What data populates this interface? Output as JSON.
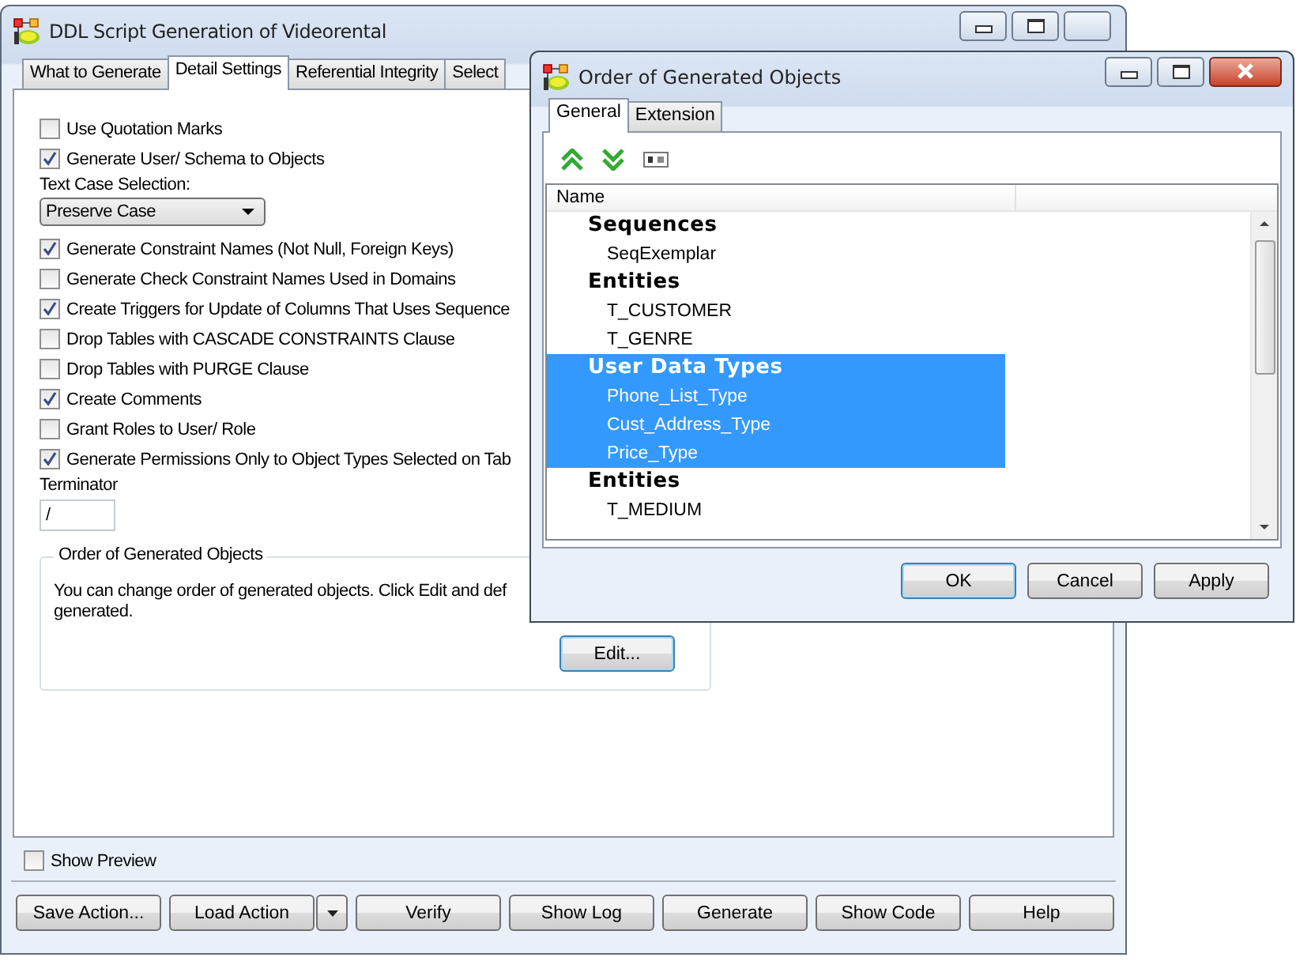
{
  "window": {
    "title": "DDL Script Generation of Videorental"
  },
  "tabs": [
    {
      "label": "What to Generate",
      "selected": false
    },
    {
      "label": "Detail Settings",
      "selected": true
    },
    {
      "label": "Referential Integrity",
      "selected": false
    },
    {
      "label": "Select",
      "selected": false
    }
  ],
  "settings": [
    {
      "kind": "checkbox",
      "label": "Use Quotation Marks",
      "checked": false
    },
    {
      "kind": "checkbox",
      "label": "Generate User/ Schema to Objects",
      "checked": true
    },
    {
      "kind": "dropdown",
      "label": "Text Case Selection:",
      "value": "Preserve Case"
    },
    {
      "kind": "checkbox",
      "label": "Generate Constraint Names (Not Null, Foreign Keys)",
      "checked": true
    },
    {
      "kind": "checkbox",
      "label": "Generate Check Constraint Names Used in Domains",
      "checked": false
    },
    {
      "kind": "checkbox",
      "label": "Create Triggers for Update of Columns That Uses Sequence",
      "checked": true
    },
    {
      "kind": "checkbox",
      "label": "Drop Tables with CASCADE CONSTRAINTS Clause",
      "checked": false
    },
    {
      "kind": "checkbox",
      "label": "Drop Tables with PURGE Clause",
      "checked": false
    },
    {
      "kind": "checkbox",
      "label": "Create Comments",
      "checked": true
    },
    {
      "kind": "checkbox",
      "label": "Grant Roles to User/ Role",
      "checked": false
    },
    {
      "kind": "checkbox",
      "label": "Generate Permissions Only to Object Types Selected on Tab",
      "checked": true
    },
    {
      "kind": "field",
      "label": "Terminator",
      "value": "/"
    }
  ],
  "order_group": {
    "title": "Order of Generated Objects",
    "lines": [
      "You can change order of generated objects. Click Edit and def",
      "generated."
    ],
    "button": "Edit..."
  },
  "show_preview": {
    "label": "Show Preview",
    "checked": false
  },
  "buttons": [
    "Save Action...",
    "Load Action",
    "Verify",
    "Show Log",
    "Generate",
    "Show Code",
    "Help"
  ],
  "dialog": {
    "title": "Order of Generated Objects",
    "tabs": [
      {
        "label": "General",
        "selected": true
      },
      {
        "label": "Extension",
        "selected": false
      }
    ],
    "columns": [
      "Name"
    ],
    "groups": [
      {
        "label": "Sequences",
        "selected": false,
        "children": [
          {
            "label": "SeqExemplar",
            "selected": false
          }
        ]
      },
      {
        "label": "Entities",
        "selected": false,
        "children": [
          {
            "label": "T_CUSTOMER",
            "selected": false
          },
          {
            "label": "T_GENRE",
            "selected": false
          }
        ]
      },
      {
        "label": "User Data Types",
        "selected": true,
        "children": [
          {
            "label": "Phone_List_Type",
            "selected": true
          },
          {
            "label": "Cust_Address_Type",
            "selected": true
          },
          {
            "label": "Price_Type",
            "selected": true
          }
        ]
      },
      {
        "label": "Entities",
        "selected": false,
        "children": [
          {
            "label": "T_MEDIUM",
            "selected": false
          }
        ]
      }
    ],
    "buttons": [
      {
        "label": "OK",
        "default": true
      },
      {
        "label": "Cancel",
        "default": false
      },
      {
        "label": "Apply",
        "default": false
      }
    ]
  }
}
